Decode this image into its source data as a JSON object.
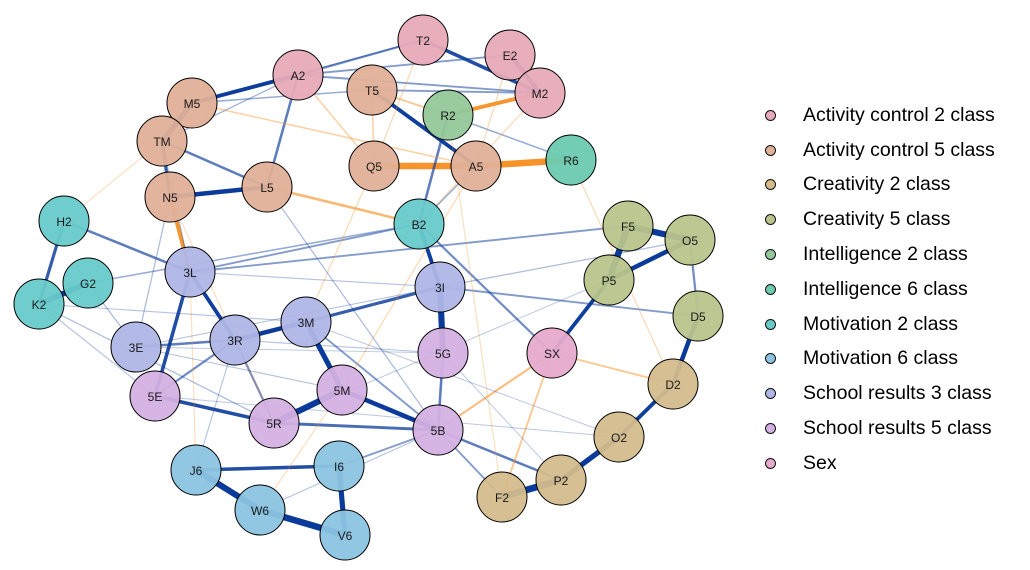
{
  "groups": [
    {
      "id": "ac2",
      "label": "Activity control 2 class",
      "color": "#E8AAB8"
    },
    {
      "id": "ac5",
      "label": "Activity control 5 class",
      "color": "#E0B098"
    },
    {
      "id": "cr2",
      "label": "Creativity 2 class",
      "color": "#D4BC8C"
    },
    {
      "id": "cr5",
      "label": "Creativity 5 class",
      "color": "#B8C48C"
    },
    {
      "id": "in2",
      "label": "Intelligence 2 class",
      "color": "#94C89A"
    },
    {
      "id": "in6",
      "label": "Intelligence 6 class",
      "color": "#6CCAB0"
    },
    {
      "id": "mo2",
      "label": "Motivation 2 class",
      "color": "#68CACA"
    },
    {
      "id": "mo6",
      "label": "Motivation 6 class",
      "color": "#8CC4E2"
    },
    {
      "id": "sr3",
      "label": "School results 3 class",
      "color": "#B0B6E6"
    },
    {
      "id": "sr5",
      "label": "School results 5 class",
      "color": "#D4B0E2"
    },
    {
      "id": "sex",
      "label": "Sex",
      "color": "#E6AACE"
    }
  ],
  "nodes": [
    {
      "id": "T2",
      "group": "ac2"
    },
    {
      "id": "E2",
      "group": "ac2"
    },
    {
      "id": "A2",
      "group": "ac2"
    },
    {
      "id": "M2",
      "group": "ac2"
    },
    {
      "id": "T5",
      "group": "ac5"
    },
    {
      "id": "M5",
      "group": "ac5"
    },
    {
      "id": "TM",
      "group": "ac5"
    },
    {
      "id": "Q5",
      "group": "ac5"
    },
    {
      "id": "A5",
      "group": "ac5"
    },
    {
      "id": "N5",
      "group": "ac5"
    },
    {
      "id": "L5",
      "group": "ac5"
    },
    {
      "id": "R2",
      "group": "in2"
    },
    {
      "id": "R6",
      "group": "in6"
    },
    {
      "id": "H2",
      "group": "mo2"
    },
    {
      "id": "G2",
      "group": "mo2"
    },
    {
      "id": "K2",
      "group": "mo2"
    },
    {
      "id": "B2",
      "group": "mo2"
    },
    {
      "id": "F5",
      "group": "cr5"
    },
    {
      "id": "O5",
      "group": "cr5"
    },
    {
      "id": "P5",
      "group": "cr5"
    },
    {
      "id": "D5",
      "group": "cr5"
    },
    {
      "id": "D2",
      "group": "cr2"
    },
    {
      "id": "O2",
      "group": "cr2"
    },
    {
      "id": "P2",
      "group": "cr2"
    },
    {
      "id": "F2",
      "group": "cr2"
    },
    {
      "id": "3L",
      "group": "sr3"
    },
    {
      "id": "3I",
      "group": "sr3"
    },
    {
      "id": "3M",
      "group": "sr3"
    },
    {
      "id": "3R",
      "group": "sr3"
    },
    {
      "id": "3E",
      "group": "sr3"
    },
    {
      "id": "5G",
      "group": "sr5"
    },
    {
      "id": "5E",
      "group": "sr5"
    },
    {
      "id": "5M",
      "group": "sr5"
    },
    {
      "id": "5R",
      "group": "sr5"
    },
    {
      "id": "5B",
      "group": "sr5"
    },
    {
      "id": "SX",
      "group": "sex"
    },
    {
      "id": "J6",
      "group": "mo6"
    },
    {
      "id": "I6",
      "group": "mo6"
    },
    {
      "id": "W6",
      "group": "mo6"
    },
    {
      "id": "V6",
      "group": "mo6"
    }
  ],
  "edges": [
    {
      "from": "Q5",
      "to": "A5",
      "sign": "neg",
      "weight": 0.9
    },
    {
      "from": "A5",
      "to": "R6",
      "sign": "neg",
      "weight": 0.9
    },
    {
      "from": "R2",
      "to": "M2",
      "sign": "neg",
      "weight": 0.5
    },
    {
      "from": "N5",
      "to": "3L",
      "sign": "neg",
      "weight": 0.5
    },
    {
      "from": "M5",
      "to": "A2",
      "sign": "pos",
      "weight": 0.5
    },
    {
      "from": "N5",
      "to": "L5",
      "sign": "pos",
      "weight": 0.6
    },
    {
      "from": "T2",
      "to": "M2",
      "sign": "pos",
      "weight": 0.45
    },
    {
      "from": "T5",
      "to": "A5",
      "sign": "pos",
      "weight": 0.5
    },
    {
      "from": "M5",
      "to": "TM",
      "sign": "pos",
      "weight": 0.7
    },
    {
      "from": "TM",
      "to": "N5",
      "sign": "pos",
      "weight": 0.4
    },
    {
      "from": "E2",
      "to": "M2",
      "sign": "pos",
      "weight": 0.6
    },
    {
      "from": "H2",
      "to": "K2",
      "sign": "pos",
      "weight": 0.4
    },
    {
      "from": "K2",
      "to": "G2",
      "sign": "pos",
      "weight": 0.8
    },
    {
      "from": "B2",
      "to": "3I",
      "sign": "pos",
      "weight": 0.5
    },
    {
      "from": "3I",
      "to": "5G",
      "sign": "pos",
      "weight": 0.85
    },
    {
      "from": "F5",
      "to": "O5",
      "sign": "pos",
      "weight": 0.85
    },
    {
      "from": "F5",
      "to": "P5",
      "sign": "pos",
      "weight": 0.9
    },
    {
      "from": "P5",
      "to": "O5",
      "sign": "pos",
      "weight": 0.6
    },
    {
      "from": "O5",
      "to": "D5",
      "sign": "pos",
      "weight": 0.25
    },
    {
      "from": "D5",
      "to": "D2",
      "sign": "pos",
      "weight": 0.6
    },
    {
      "from": "D2",
      "to": "O2",
      "sign": "pos",
      "weight": 0.5
    },
    {
      "from": "O2",
      "to": "P2",
      "sign": "pos",
      "weight": 0.7
    },
    {
      "from": "P2",
      "to": "F2",
      "sign": "pos",
      "weight": 0.95
    },
    {
      "from": "P5",
      "to": "SX",
      "sign": "pos",
      "weight": 0.5
    },
    {
      "from": "3L",
      "to": "3R",
      "sign": "pos",
      "weight": 0.5
    },
    {
      "from": "3L",
      "to": "5E",
      "sign": "pos",
      "weight": 0.45
    },
    {
      "from": "3R",
      "to": "3M",
      "sign": "pos",
      "weight": 0.6
    },
    {
      "from": "3M",
      "to": "5M",
      "sign": "pos",
      "weight": 0.7
    },
    {
      "from": "3M",
      "to": "3I",
      "sign": "pos",
      "weight": 0.4
    },
    {
      "from": "5M",
      "to": "5R",
      "sign": "pos",
      "weight": 0.85
    },
    {
      "from": "5M",
      "to": "5B",
      "sign": "pos",
      "weight": 0.6
    },
    {
      "from": "5E",
      "to": "5R",
      "sign": "pos",
      "weight": 0.45
    },
    {
      "from": "5R",
      "to": "5B",
      "sign": "pos",
      "weight": 0.35
    },
    {
      "from": "5G",
      "to": "5B",
      "sign": "pos",
      "weight": 0.3
    },
    {
      "from": "J6",
      "to": "W6",
      "sign": "pos",
      "weight": 0.85
    },
    {
      "from": "W6",
      "to": "V6",
      "sign": "pos",
      "weight": 0.9
    },
    {
      "from": "I6",
      "to": "V6",
      "sign": "pos",
      "weight": 0.7
    },
    {
      "from": "J6",
      "to": "I6",
      "sign": "pos",
      "weight": 0.45
    },
    {
      "from": "A2",
      "to": "L5",
      "sign": "pos",
      "weight": 0.3
    },
    {
      "from": "A2",
      "to": "T2",
      "sign": "pos",
      "weight": 0.25
    },
    {
      "from": "A2",
      "to": "E2",
      "sign": "pos",
      "weight": 0.2
    },
    {
      "from": "A2",
      "to": "M2",
      "sign": "pos",
      "weight": 0.2
    },
    {
      "from": "T5",
      "to": "M2",
      "sign": "pos",
      "weight": 0.2
    },
    {
      "from": "R2",
      "to": "B2",
      "sign": "pos",
      "weight": 0.3
    },
    {
      "from": "H2",
      "to": "3L",
      "sign": "pos",
      "weight": 0.3
    },
    {
      "from": "TM",
      "to": "L5",
      "sign": "pos",
      "weight": 0.3
    },
    {
      "from": "B2",
      "to": "SX",
      "sign": "pos",
      "weight": 0.25
    },
    {
      "from": "3E",
      "to": "3R",
      "sign": "pos",
      "weight": 0.3
    },
    {
      "from": "3R",
      "to": "5E",
      "sign": "pos",
      "weight": 0.25
    },
    {
      "from": "3R",
      "to": "5R",
      "sign": "pos",
      "weight": 0.25
    },
    {
      "from": "3M",
      "to": "5B",
      "sign": "pos",
      "weight": 0.2
    },
    {
      "from": "5B",
      "to": "P2",
      "sign": "pos",
      "weight": 0.3
    },
    {
      "from": "5B",
      "to": "F2",
      "sign": "pos",
      "weight": 0.2
    },
    {
      "from": "I6",
      "to": "5B",
      "sign": "pos",
      "weight": 0.2
    },
    {
      "from": "3L",
      "to": "F5",
      "sign": "pos",
      "weight": 0.2
    },
    {
      "from": "3I",
      "to": "D5",
      "sign": "pos",
      "weight": 0.2
    },
    {
      "from": "G2",
      "to": "B2",
      "sign": "pos",
      "weight": 0.15
    },
    {
      "from": "3L",
      "to": "B2",
      "sign": "pos",
      "weight": 0.2
    },
    {
      "from": "A5",
      "to": "B2",
      "sign": "pos",
      "weight": 0.15
    },
    {
      "from": "R2",
      "to": "R6",
      "sign": "pos",
      "weight": 0.15
    },
    {
      "from": "M5",
      "to": "T5",
      "sign": "pos",
      "weight": 0.15
    },
    {
      "from": "L5",
      "to": "B2",
      "sign": "neg",
      "weight": 0.3
    },
    {
      "from": "5B",
      "to": "SX",
      "sign": "neg",
      "weight": 0.25
    },
    {
      "from": "SX",
      "to": "D2",
      "sign": "neg",
      "weight": 0.2
    },
    {
      "from": "SX",
      "to": "F2",
      "sign": "neg",
      "weight": 0.2
    },
    {
      "from": "T5",
      "to": "R2",
      "sign": "neg",
      "weight": 0.2
    },
    {
      "from": "T5",
      "to": "Q5",
      "sign": "neg",
      "weight": 0.15
    },
    {
      "from": "M5",
      "to": "A5",
      "sign": "neg",
      "weight": 0.15
    },
    {
      "from": "A2",
      "to": "Q5",
      "sign": "neg",
      "weight": 0.15
    },
    {
      "from": "T2",
      "to": "Q5",
      "sign": "neg",
      "weight": 0.1
    },
    {
      "from": "E2",
      "to": "A5",
      "sign": "neg",
      "weight": 0.1
    },
    {
      "from": "M2",
      "to": "B2",
      "sign": "neg",
      "weight": 0.1
    },
    {
      "from": "R6",
      "to": "D2",
      "sign": "neg",
      "weight": 0.1
    },
    {
      "from": "Q5",
      "to": "3M",
      "sign": "neg",
      "weight": 0.1
    },
    {
      "from": "A5",
      "to": "5M",
      "sign": "neg",
      "weight": 0.1
    },
    {
      "from": "H2",
      "to": "TM",
      "sign": "neg",
      "weight": 0.08
    },
    {
      "from": "N5",
      "to": "5R",
      "sign": "neg",
      "weight": 0.08
    },
    {
      "from": "3L",
      "to": "J6",
      "sign": "neg",
      "weight": 0.08
    },
    {
      "from": "W6",
      "to": "5M",
      "sign": "neg",
      "weight": 0.08
    },
    {
      "from": "R2",
      "to": "F2",
      "sign": "neg",
      "weight": 0.08
    },
    {
      "from": "K2",
      "to": "5R",
      "sign": "pos",
      "weight": 0.1
    },
    {
      "from": "G2",
      "to": "3E",
      "sign": "pos",
      "weight": 0.1
    },
    {
      "from": "K2",
      "to": "3M",
      "sign": "pos",
      "weight": 0.08
    },
    {
      "from": "3E",
      "to": "5M",
      "sign": "pos",
      "weight": 0.08
    },
    {
      "from": "3L",
      "to": "3I",
      "sign": "pos",
      "weight": 0.08
    },
    {
      "from": "3E",
      "to": "3I",
      "sign": "pos",
      "weight": 0.08
    },
    {
      "from": "L5",
      "to": "5B",
      "sign": "pos",
      "weight": 0.1
    },
    {
      "from": "3R",
      "to": "5G",
      "sign": "pos",
      "weight": 0.08
    },
    {
      "from": "5E",
      "to": "O2",
      "sign": "pos",
      "weight": 0.06
    },
    {
      "from": "3M",
      "to": "O2",
      "sign": "pos",
      "weight": 0.06
    },
    {
      "from": "5R",
      "to": "P5",
      "sign": "pos",
      "weight": 0.06
    },
    {
      "from": "3E",
      "to": "5G",
      "sign": "pos",
      "weight": 0.06
    },
    {
      "from": "J6",
      "to": "3R",
      "sign": "pos",
      "weight": 0.08
    },
    {
      "from": "W6",
      "to": "5B",
      "sign": "pos",
      "weight": 0.08
    },
    {
      "from": "TM",
      "to": "3L",
      "sign": "pos",
      "weight": 0.1
    },
    {
      "from": "3E",
      "to": "N5",
      "sign": "pos",
      "weight": 0.1
    },
    {
      "from": "5E",
      "to": "K2",
      "sign": "pos",
      "weight": 0.08
    },
    {
      "from": "P2",
      "to": "5G",
      "sign": "pos",
      "weight": 0.06
    },
    {
      "from": "O5",
      "to": "3I",
      "sign": "pos",
      "weight": 0.1
    },
    {
      "from": "A2",
      "to": "TM",
      "sign": "pos",
      "weight": 0.12
    },
    {
      "from": "T2",
      "to": "M5",
      "sign": "pos",
      "weight": 0.12
    }
  ]
}
